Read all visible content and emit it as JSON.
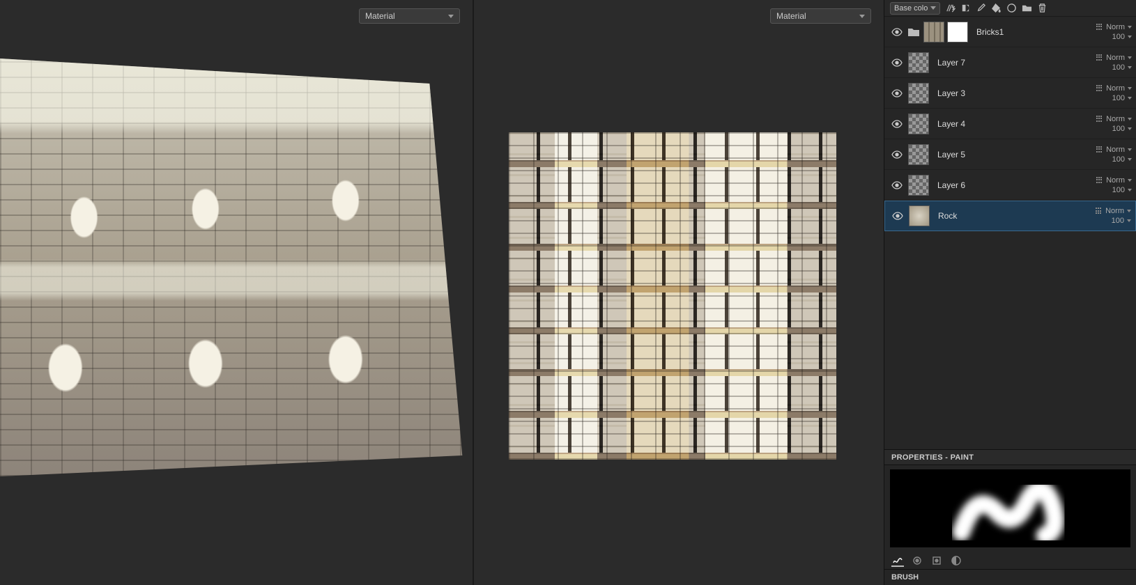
{
  "viewports": {
    "left_dropdown": "Material",
    "right_dropdown": "Material"
  },
  "layers_panel": {
    "channel_dropdown": "Base colo",
    "layers": [
      {
        "name": "Bricks1",
        "blend": "Norm",
        "opacity": "100",
        "has_folder": true,
        "thumb_class": "bricks",
        "has_mask": true
      },
      {
        "name": "Layer 7",
        "blend": "Norm",
        "opacity": "100",
        "thumb_class": "checker"
      },
      {
        "name": "Layer 3",
        "blend": "Norm",
        "opacity": "100",
        "thumb_class": "checker"
      },
      {
        "name": "Layer 4",
        "blend": "Norm",
        "opacity": "100",
        "thumb_class": "checker"
      },
      {
        "name": "Layer 5",
        "blend": "Norm",
        "opacity": "100",
        "thumb_class": "checker"
      },
      {
        "name": "Layer 6",
        "blend": "Norm",
        "opacity": "100",
        "thumb_class": "checker"
      },
      {
        "name": "Rock",
        "blend": "Norm",
        "opacity": "100",
        "thumb_class": "rock",
        "selected": true
      }
    ]
  },
  "properties": {
    "title": "PROPERTIES - PAINT",
    "brush_section": "BRUSH"
  }
}
